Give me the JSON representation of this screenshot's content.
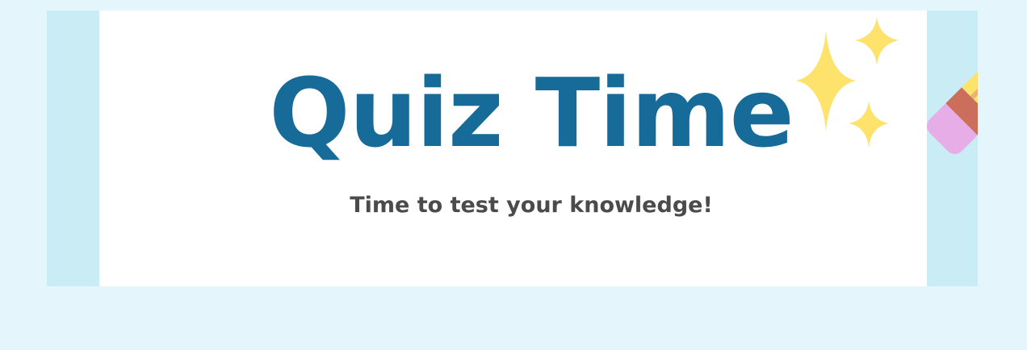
{
  "banner": {
    "title": "Quiz Time",
    "subtitle": "Time to test your knowledge!"
  },
  "decorations": {
    "icons": [
      "sparkle-icon",
      "pencil-icon"
    ]
  },
  "colors": {
    "page_background": "#e5f5fc",
    "side_panel": "#c9ecf5",
    "card": "#ffffff",
    "title": "#176b98",
    "subtitle": "#4b4b4b",
    "sparkle": "#fde36c",
    "pencil_body": "#fde36c",
    "pencil_stripe": "#e8b475",
    "pencil_ferrule": "#cc6e5c",
    "pencil_eraser": "#e6ade6"
  }
}
